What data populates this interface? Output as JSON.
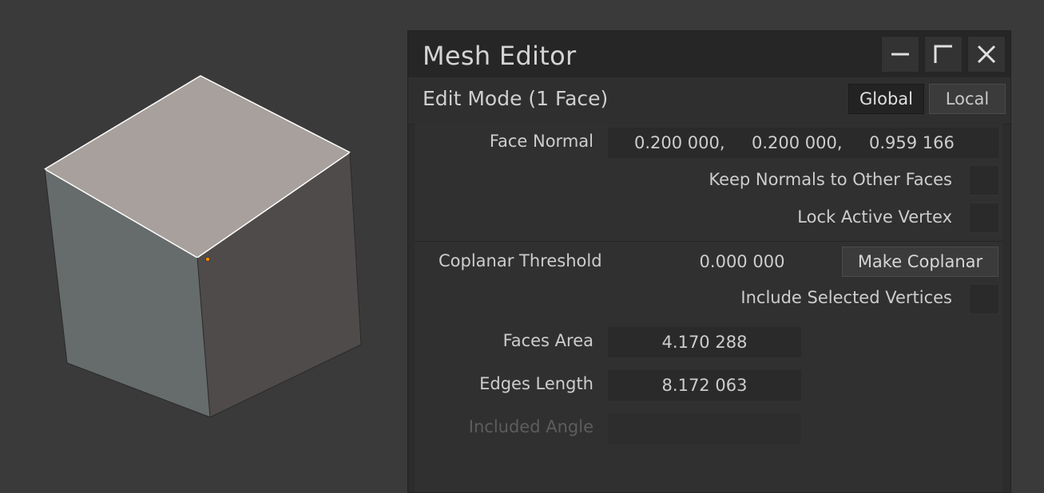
{
  "viewport": {
    "cube": {
      "top_color": "#a8a09c",
      "left_color": "#666b6b",
      "right_color": "#4f4b4a",
      "selected_edge_color": "#ffffff",
      "active_vertex_color": "#ff8c00"
    }
  },
  "panel": {
    "title": "Mesh Editor",
    "window_buttons": [
      "minimize-icon",
      "maximize-icon",
      "close-icon"
    ],
    "mode": {
      "label": "Edit Mode (1 Face)",
      "global_label": "Global",
      "local_label": "Local",
      "active": "Global"
    },
    "face_normal": {
      "label": "Face Normal",
      "x": "0.200 000,",
      "y": "0.200 000,",
      "z": "0.959 166"
    },
    "keep_normals": {
      "label": "Keep Normals to Other Faces",
      "checked": false
    },
    "lock_active_vertex": {
      "label": "Lock Active Vertex",
      "checked": false
    },
    "coplanar": {
      "label": "Coplanar Threshold",
      "value": "0.000 000",
      "button": "Make Coplanar"
    },
    "include_selected": {
      "label": "Include Selected Vertices",
      "checked": false
    },
    "faces_area": {
      "label": "Faces Area",
      "value": "4.170 288"
    },
    "edges_length": {
      "label": "Edges Length",
      "value": "8.172 063"
    },
    "included_angle": {
      "label": "Included Angle",
      "value": ""
    }
  }
}
